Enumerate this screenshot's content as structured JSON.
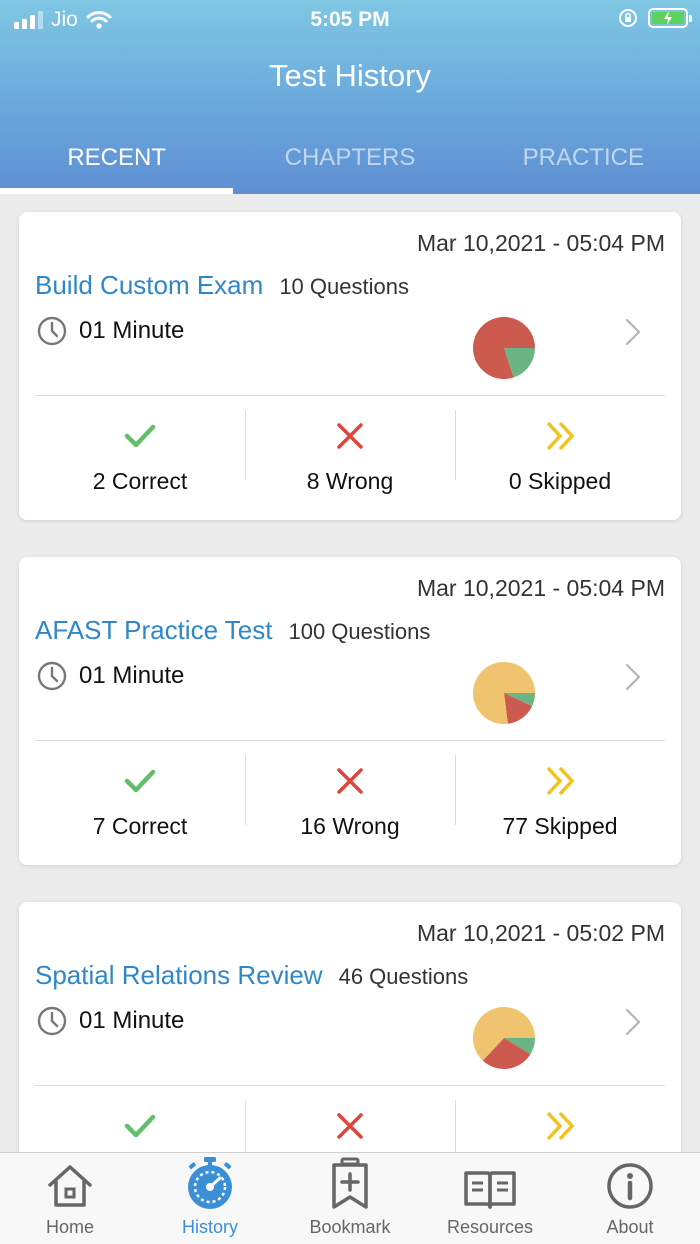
{
  "status_bar": {
    "carrier": "Jio",
    "time": "5:05 PM"
  },
  "header": {
    "title": "Test History",
    "tabs": [
      {
        "label": "RECENT",
        "active": true
      },
      {
        "label": "CHAPTERS",
        "active": false
      },
      {
        "label": "PRACTICE",
        "active": false
      }
    ]
  },
  "colors": {
    "correct": "#62be6a",
    "wrong": "#e0443a",
    "skipped": "#f3c21b",
    "pie_correct": "#6ab583",
    "pie_wrong": "#cd5a4f",
    "pie_skipped": "#f0c46e",
    "link": "#2f87c8",
    "active_tab": "#3b8fd6"
  },
  "tests": [
    {
      "date": "Mar 10,2021 - 05:04 PM",
      "name": "Build Custom Exam",
      "questions": "10 Questions",
      "duration": "01 Minute",
      "correct": 2,
      "wrong": 8,
      "skipped": 0,
      "correct_label": "2 Correct",
      "wrong_label": "8 Wrong",
      "skipped_label": "0 Skipped"
    },
    {
      "date": "Mar 10,2021 - 05:04 PM",
      "name": "AFAST Practice Test",
      "questions": "100 Questions",
      "duration": "01 Minute",
      "correct": 7,
      "wrong": 16,
      "skipped": 77,
      "correct_label": "7 Correct",
      "wrong_label": "16 Wrong",
      "skipped_label": "77 Skipped"
    },
    {
      "date": "Mar 10,2021 - 05:02 PM",
      "name": "Spatial Relations Review",
      "questions": "46 Questions",
      "duration": "01 Minute",
      "correct": 4,
      "wrong": 13,
      "skipped": 29,
      "correct_label": "",
      "wrong_label": "",
      "skipped_label": ""
    }
  ],
  "tab_bar": [
    {
      "label": "Home",
      "icon": "home-icon",
      "active": false
    },
    {
      "label": "History",
      "icon": "stopwatch-icon",
      "active": true
    },
    {
      "label": "Bookmark",
      "icon": "bookmark-plus-icon",
      "active": false
    },
    {
      "label": "Resources",
      "icon": "open-book-icon",
      "active": false
    },
    {
      "label": "About",
      "icon": "info-icon",
      "active": false
    }
  ]
}
